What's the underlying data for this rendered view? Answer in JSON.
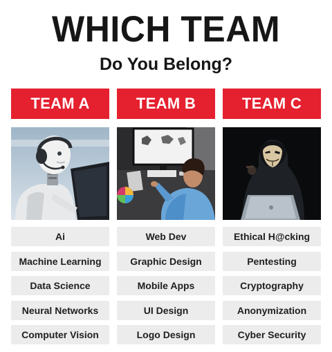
{
  "title": "WHICH TEAM",
  "subtitle": "Do You Belong?",
  "teams": [
    {
      "name": "TEAM A",
      "items": [
        "Ai",
        "Machine Learning",
        "Data Science",
        "Neural Networks",
        "Computer Vision"
      ]
    },
    {
      "name": "TEAM B",
      "items": [
        "Web Dev",
        "Graphic Design",
        "Mobile Apps",
        "UI Design",
        "Logo Design"
      ]
    },
    {
      "name": "TEAM C",
      "items": [
        "Ethical H@cking",
        "Pentesting",
        "Cryptography",
        "Anonymization",
        "Cyber Security"
      ]
    }
  ],
  "colors": {
    "accent": "#e5202f",
    "item_bg": "#ececec",
    "text": "#161616"
  }
}
